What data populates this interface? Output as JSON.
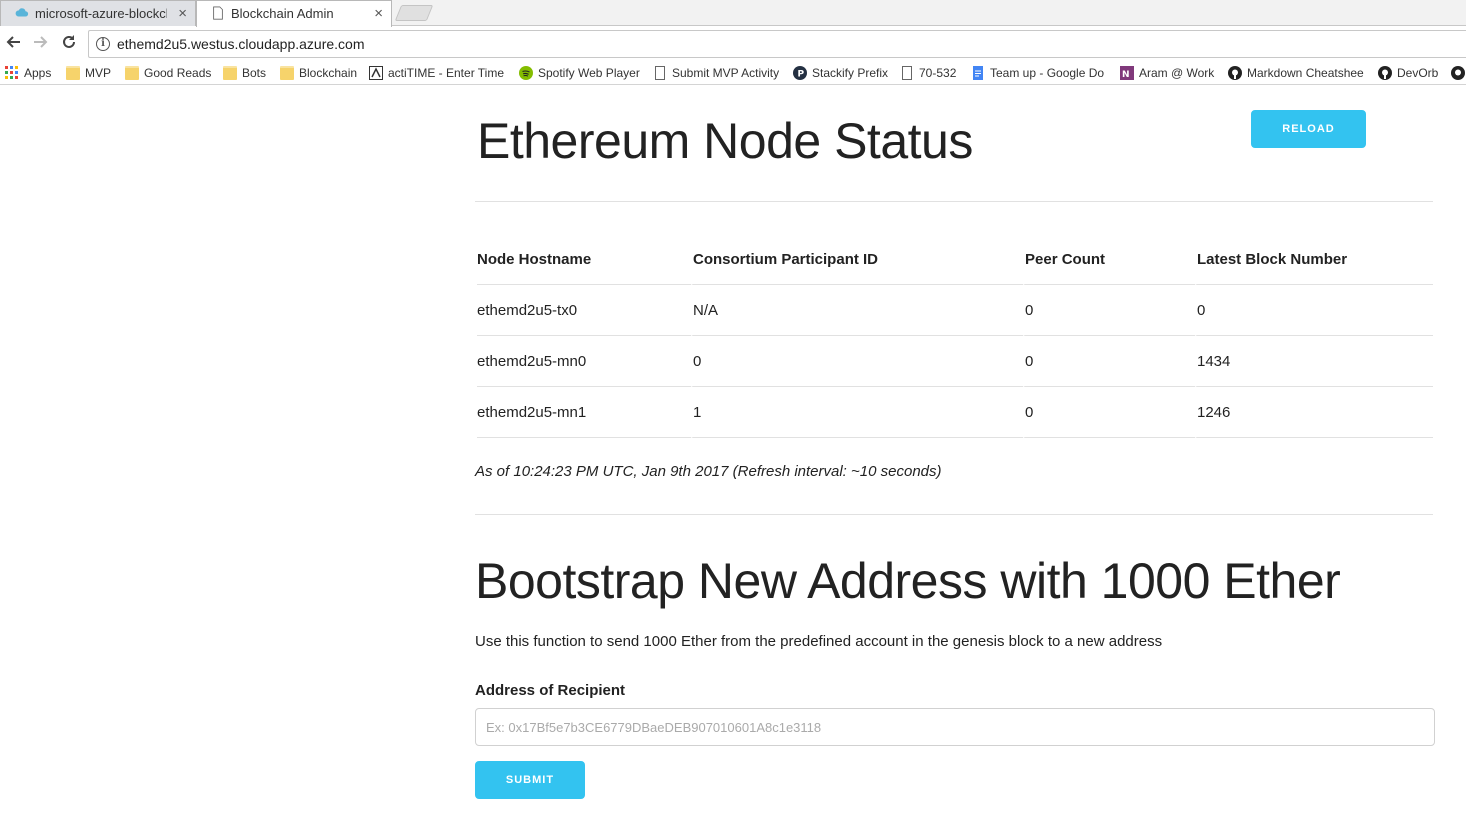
{
  "browser": {
    "tabs": [
      {
        "title": "microsoft-azure-blockch",
        "icon": "cloud-icon",
        "active": false
      },
      {
        "title": "Blockchain Admin",
        "icon": "page-icon",
        "active": true
      }
    ],
    "url": "ethemd2u5.westus.cloudapp.azure.com",
    "bookmarks": [
      {
        "label": "Apps",
        "icon": "apps-grid-icon"
      },
      {
        "label": "MVP",
        "icon": "folder-icon"
      },
      {
        "label": "Good Reads",
        "icon": "folder-icon"
      },
      {
        "label": "Bots",
        "icon": "folder-icon"
      },
      {
        "label": "Blockchain",
        "icon": "folder-icon"
      },
      {
        "label": "actiTIME - Enter Time",
        "icon": "actitime-icon"
      },
      {
        "label": "Spotify Web Player",
        "icon": "spotify-icon"
      },
      {
        "label": "Submit MVP Activity",
        "icon": "page-icon"
      },
      {
        "label": "Stackify Prefix",
        "icon": "stackify-icon"
      },
      {
        "label": "70-532",
        "icon": "page-icon"
      },
      {
        "label": "Team up - Google Do",
        "icon": "google-docs-icon"
      },
      {
        "label": "Aram @ Work",
        "icon": "onenote-icon"
      },
      {
        "label": "Markdown Cheatshee",
        "icon": "github-icon"
      },
      {
        "label": "DevOrb",
        "icon": "github-icon"
      }
    ]
  },
  "status": {
    "title": "Ethereum Node Status",
    "reload_label": "Reload",
    "columns": [
      "Node Hostname",
      "Consortium Participant ID",
      "Peer Count",
      "Latest Block Number"
    ],
    "rows": [
      [
        "ethemd2u5-tx0",
        "N/A",
        "0",
        "0"
      ],
      [
        "ethemd2u5-mn0",
        "0",
        "0",
        "1434"
      ],
      [
        "ethemd2u5-mn1",
        "1",
        "0",
        "1246"
      ]
    ],
    "timestamp": "As of 10:24:23 PM UTC, Jan 9th 2017 (Refresh interval: ~10 seconds)"
  },
  "bootstrap": {
    "title": "Bootstrap New Address with 1000 Ether",
    "description": "Use this function to send 1000 Ether from the predefined account in the genesis block to a new address",
    "field_label": "Address of Recipient",
    "placeholder": "Ex: 0x17Bf5e7b3CE6779DBaeDEB907010601A8c1e3118",
    "value": "",
    "submit_label": "Submit"
  },
  "colors": {
    "accent": "#33c3f0",
    "text": "#222222",
    "divider": "#e1e1e1"
  }
}
